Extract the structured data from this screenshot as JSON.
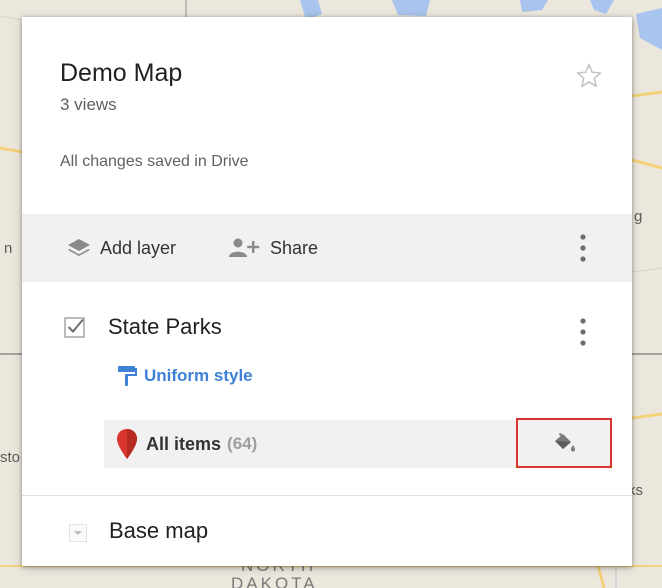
{
  "map_labels": {
    "left_n": "n",
    "left_st": "sto",
    "right_g": "g",
    "right_ks": "ks",
    "north": "NORTH",
    "dakota": "DAKOTA"
  },
  "header": {
    "title": "Demo Map",
    "views": "3 views",
    "save_status": "All changes saved in Drive"
  },
  "toolbar": {
    "add_layer_label": "Add layer",
    "share_label": "Share"
  },
  "layer": {
    "name": "State Parks",
    "checked": true,
    "style_label": "Uniform style",
    "items_label": "All items",
    "items_count": "(64)"
  },
  "basemap": {
    "label": "Base map"
  },
  "icons": {
    "star": "star-outline-icon",
    "layers": "layers-icon",
    "share": "person-add-icon",
    "more": "more-vert-icon",
    "check": "checkmark-icon",
    "style": "paint-roller-icon",
    "pin": "map-pin-icon",
    "paint": "paint-bucket-icon",
    "expand": "chevron-down-icon"
  },
  "colors": {
    "link_blue": "#3d82d6",
    "pin_red": "#d9352c",
    "highlight_border": "#d9352c",
    "toolbar_bg": "#f1f1f1"
  }
}
